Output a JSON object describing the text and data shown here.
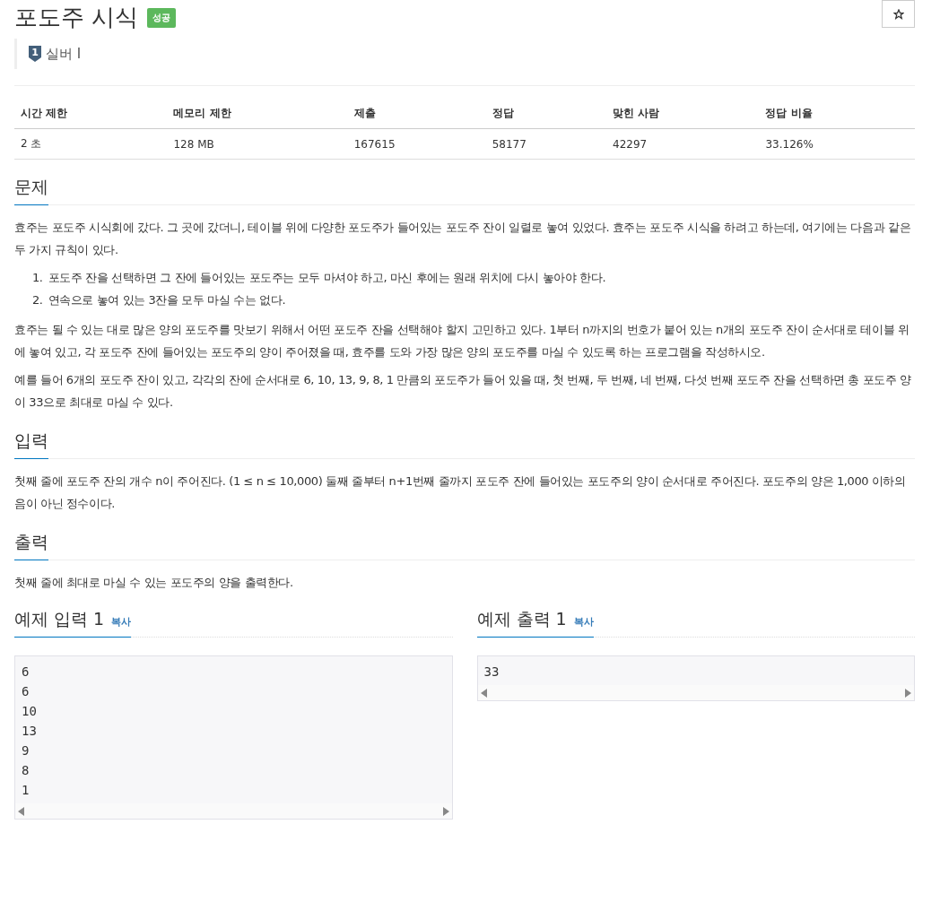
{
  "problem": {
    "title": "포도주 시식",
    "result_badge": "성공",
    "tier": {
      "number": "1",
      "name": "실버 I"
    }
  },
  "info_table": {
    "columns": [
      "시간 제한",
      "메모리 제한",
      "제출",
      "정답",
      "맞힌 사람",
      "정답 비율"
    ],
    "rows": [
      [
        "2 초",
        "128 MB",
        "167615",
        "58177",
        "42297",
        "33.126%"
      ]
    ]
  },
  "sections": [
    {
      "heading": "문제",
      "blocks": [
        {
          "kind": "paragraph",
          "text": "효주는 포도주 시식회에 갔다. 그 곳에 갔더니, 테이블 위에 다양한 포도주가 들어있는 포도주 잔이 일렬로 놓여 있었다. 효주는 포도주 시식을 하려고 하는데, 여기에는 다음과 같은 두 가지 규칙이 있다."
        },
        {
          "kind": "ordered_list",
          "items": [
            {
              "number": "1.",
              "text": "포도주 잔을 선택하면 그 잔에 들어있는 포도주는 모두 마셔야 하고, 마신 후에는 원래 위치에 다시 놓아야 한다."
            },
            {
              "number": "2.",
              "text": "연속으로 놓여 있는 3잔을 모두 마실 수는 없다."
            }
          ]
        },
        {
          "kind": "paragraph",
          "text": "효주는 될 수 있는 대로 많은 양의 포도주를 맛보기 위해서 어떤 포도주 잔을 선택해야 할지 고민하고 있다. 1부터 n까지의 번호가 붙어 있는 n개의 포도주 잔이 순서대로 테이블 위에 놓여 있고, 각 포도주 잔에 들어있는 포도주의 양이 주어졌을 때, 효주를 도와 가장 많은 양의 포도주를 마실 수 있도록 하는 프로그램을 작성하시오."
        },
        {
          "kind": "paragraph",
          "text": "예를 들어 6개의 포도주 잔이 있고, 각각의 잔에 순서대로 6, 10, 13, 9, 8, 1 만큼의 포도주가 들어 있을 때, 첫 번째, 두 번째, 네 번째, 다섯 번째 포도주 잔을 선택하면 총 포도주 양이 33으로 최대로 마실 수 있다."
        }
      ]
    },
    {
      "heading": "입력",
      "blocks": [
        {
          "kind": "paragraph",
          "text": "첫째 줄에 포도주 잔의 개수 n이 주어진다. (1 ≤ n ≤ 10,000) 둘째 줄부터 n+1번째 줄까지 포도주 잔에 들어있는 포도주의 양이 순서대로 주어진다. 포도주의 양은 1,000 이하의 음이 아닌 정수이다."
        }
      ]
    },
    {
      "heading": "출력",
      "blocks": [
        {
          "kind": "paragraph",
          "text": "첫째 줄에 최대로 마실 수 있는 포도주의 양을 출력한다."
        }
      ]
    }
  ],
  "samples": [
    {
      "heading": "예제 입력 1",
      "copy": "복사",
      "lines": [
        "6",
        "6",
        "10",
        "13",
        "9",
        "8",
        "1"
      ]
    },
    {
      "heading": "예제 출력 1",
      "copy": "복사",
      "lines": [
        "33"
      ]
    }
  ]
}
